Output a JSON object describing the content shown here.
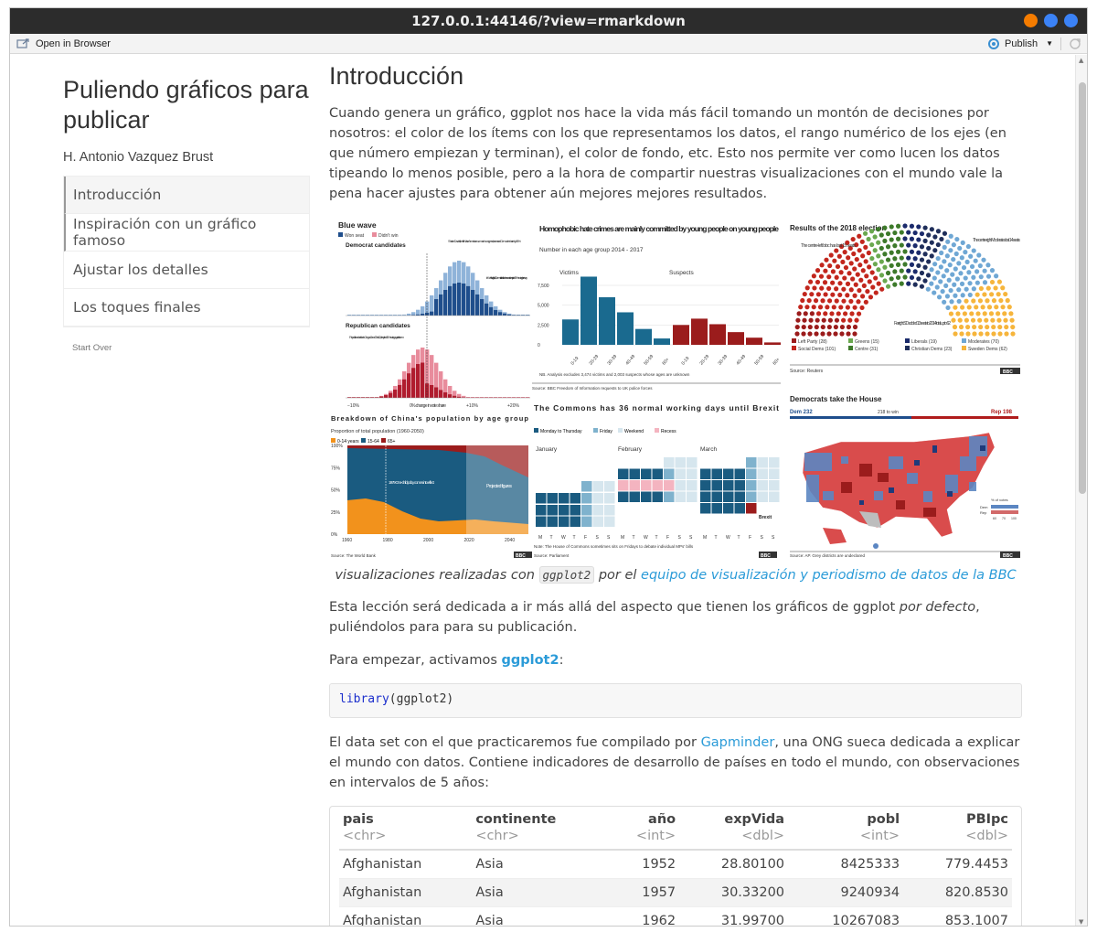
{
  "window": {
    "title": "127.0.0.1:44146/?view=rmarkdown",
    "btn_colors": [
      "#f57c00",
      "#3b82f6",
      "#3b82f6"
    ]
  },
  "toolbar": {
    "open_browser": "Open in Browser",
    "publish": "Publish"
  },
  "sidebar": {
    "title": "Puliendo gráficos para publicar",
    "author": "H. Antonio Vazquez Brust",
    "toc": [
      {
        "label": "Introducción"
      },
      {
        "label": "Inspiración con un gráfico famoso"
      },
      {
        "label": "Ajustar los detalles"
      },
      {
        "label": "Los toques finales"
      }
    ],
    "start_over": "Start Over"
  },
  "main": {
    "heading": "Introducción",
    "intro": "Cuando genera un gráfico, ggplot nos hace la vida más fácil tomando un montón de decisiones por nosotros: el color de los ítems con los que representamos los datos, el rango numérico de los ejes (en que número empiezan y terminan), el color de fondo, etc. Esto nos permite ver como lucen los datos tipeando lo menos posible, pero a la hora de compartir nuestras visualizaciones con el mundo vale la pena hacer ajustes para obtener aún mejores mejores resultados.",
    "caption_pre": "visualizaciones realizadas con",
    "caption_code": "ggplot2",
    "caption_mid": "por el",
    "caption_link": "equipo de visualización y periodismo de datos de la BBC",
    "p2_pre": "Esta lección será dedicada a ir más allá del aspecto que tienen los gráficos de ggplot",
    "p2_em": "por defecto",
    "p2_post": ", puliéndolos para para su publicación.",
    "p3_pre": "Para empezar, activamos",
    "p3_link": "ggplot2",
    "p3_post": ":",
    "code_fn": "library",
    "code_arg": "(ggplot2)",
    "p4_pre": "El data set con el que practicaremos fue compilado por",
    "p4_link": "Gapminder",
    "p4_post": ", una ONG sueca dedicada a explicar el mundo con datos. Contiene indicadores de desarrollo de países en todo el mundo, con observaciones en intervalos de 5 años:"
  },
  "table": {
    "columns": [
      {
        "name": "pais",
        "type": "<chr>",
        "align": "l"
      },
      {
        "name": "continente",
        "type": "<chr>",
        "align": "l"
      },
      {
        "name": "año",
        "type": "<int>",
        "align": "r"
      },
      {
        "name": "expVida",
        "type": "<dbl>",
        "align": "r"
      },
      {
        "name": "pobl",
        "type": "<int>",
        "align": "r"
      },
      {
        "name": "PBIpc",
        "type": "<dbl>",
        "align": "r"
      }
    ],
    "rows": [
      [
        "Afghanistan",
        "Asia",
        "1952",
        "28.80100",
        "8425333",
        "779.4453"
      ],
      [
        "Afghanistan",
        "Asia",
        "1957",
        "30.33200",
        "9240934",
        "820.8530"
      ],
      [
        "Afghanistan",
        "Asia",
        "1962",
        "31.99700",
        "10267083",
        "853.1007"
      ]
    ]
  },
  "mosaic": {
    "blue_wave": {
      "title": "Blue wave",
      "legend": [
        "Won seat",
        "Didn't win"
      ],
      "dem": "Democrat candidates",
      "rep": "Republican candidates",
      "xticks": [
        "−10%",
        "0% change in vote share",
        "+10%",
        "+20%"
      ],
      "annotations": [
        "Sharice Davids, the first Native American woman in congress, increased Dem vote share by 19%",
        "In West Virginia 3, Dems failed to turn the seat despite a 29% swing their way",
        "Republicans held onto Oregon 2 and Ohio 12, despite a 15% swing against them"
      ]
    },
    "hate": {
      "title": "Homophobic hate crimes are mainly committed by young people on young people",
      "subtitle": "Number in each age group 2014 - 2017",
      "victims": "Victims",
      "suspects": "Suspects",
      "yticks": [
        "7,500",
        "5,000",
        "2,500",
        "0"
      ],
      "ages": [
        "0-19",
        "20-29",
        "30-39",
        "40-49",
        "50-59",
        "60+"
      ],
      "victims_values": [
        3200,
        8600,
        6000,
        4100,
        2000,
        800
      ],
      "suspects_values": [
        2500,
        3300,
        2600,
        1600,
        900,
        300
      ],
      "note": "NB. Analysis excludes 3,474 victims and 2,003 suspects whose ages are unknown",
      "source": "Source: BBC Freedom of Information requests to UK police forces"
    },
    "election": {
      "title": "Results of the 2018 election",
      "ann1": "The centre-left bloc has lost 15 seats",
      "ann2": "The centre-right Moderates lost 14 seats",
      "ann3": "Far-right SD added 13 seats to 2014 total, up to 62",
      "legend": [
        "Left Party (28)",
        "Greens (15)",
        "Liberals (19)",
        "Moderates (70)",
        "Social Dems (101)",
        "Centre (31)",
        "Christian Dems (23)",
        "Sweden Dems (62)"
      ],
      "source": "Source: Reuters"
    },
    "china": {
      "title": "Breakdown of China's population by age group",
      "subtitle": "Proportion of total population (1960-2050)",
      "legend": [
        "0-14 years",
        "15-64",
        "65+"
      ],
      "yticks": [
        "100%",
        "75%",
        "50%",
        "25%",
        "0%"
      ],
      "xticks": [
        "1960",
        "1980",
        "2000",
        "2020",
        "2040"
      ],
      "ann": "1979 One-child policy comes into effect",
      "proj": "Projected figures",
      "source": "Source: The World Bank"
    },
    "commons": {
      "title": "The Commons has 36 normal working days until Brexit",
      "legend": [
        "Monday to Thursday",
        "Friday",
        "Weekend",
        "Recess"
      ],
      "months": [
        "January",
        "February",
        "March"
      ],
      "days": [
        "M",
        "T",
        "W",
        "T",
        "F",
        "S",
        "S"
      ],
      "brexit": "Brexit",
      "note": "Note: The House of Commons sometimes sits on Fridays to debate individual MPs' bills",
      "source": "Source: Parliament"
    },
    "house": {
      "title": "Democrats take the House",
      "dem": "Dem 232",
      "mid": "218 to win",
      "rep": "Rep 198",
      "legend_title": "% of votes",
      "legend_rows": [
        "Dem",
        "Rep"
      ],
      "legend_ticks": [
        "60",
        "70",
        "100"
      ],
      "source": "Source: AP. Grey districts are undeclared"
    },
    "bbc": "BBC"
  }
}
